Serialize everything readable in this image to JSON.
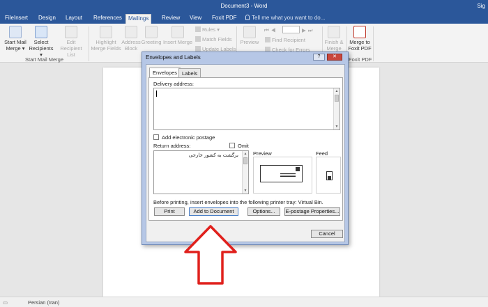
{
  "window": {
    "title": "Document3 - Word",
    "signin": "Sig"
  },
  "tabs": [
    "File",
    "Insert",
    "Design",
    "Layout",
    "References",
    "Mailings",
    "Review",
    "View",
    "Foxit PDF"
  ],
  "tell_me": "Tell me what you want to do...",
  "ribbon": {
    "start_mail_merge": "Start Mail Merge ▾",
    "select_recipients": "Select Recipients ▾",
    "edit_recipient_list": "Edit Recipient List",
    "group_start": "Start Mail Merge",
    "highlight_merge_fields": "Highlight Merge Fields",
    "address_block": "Address Block",
    "greeting": "Greeting",
    "insert_merge": "Insert Merge",
    "rules": "Rules ▾",
    "match_fields": "Match Fields",
    "update_labels": "Update Labels",
    "preview": "Preview",
    "find_recipient": "Find Recipient",
    "check_errors": "Check for Errors",
    "finish_merge": "Finish & Merge",
    "merge_to_foxit": "Merge to Foxit PDF",
    "group_foxit": "Foxit PDF"
  },
  "dialog": {
    "title": "Envelopes and Labels",
    "help": "?",
    "close": "✕",
    "tab_envelopes": "Envelopes",
    "tab_labels": "Labels",
    "delivery_label": "Delivery address:",
    "delivery_value": "",
    "add_epostage": "Add electronic postage",
    "return_label": "Return address:",
    "omit": "Omit",
    "return_value": "برگشت به کشور خارجی",
    "preview_label": "Preview",
    "feed_label": "Feed",
    "printer_note": "Before printing, insert envelopes into the following printer tray: Virtual Bin.",
    "btn_print": "Print",
    "btn_add": "Add to Document",
    "btn_options": "Options...",
    "btn_epostage": "E-postage Properties...",
    "btn_cancel": "Cancel"
  },
  "status": {
    "language": "Persian (Iran)"
  },
  "colors": {
    "title_bar": "#2b579a",
    "arrow": "#e0201c"
  }
}
